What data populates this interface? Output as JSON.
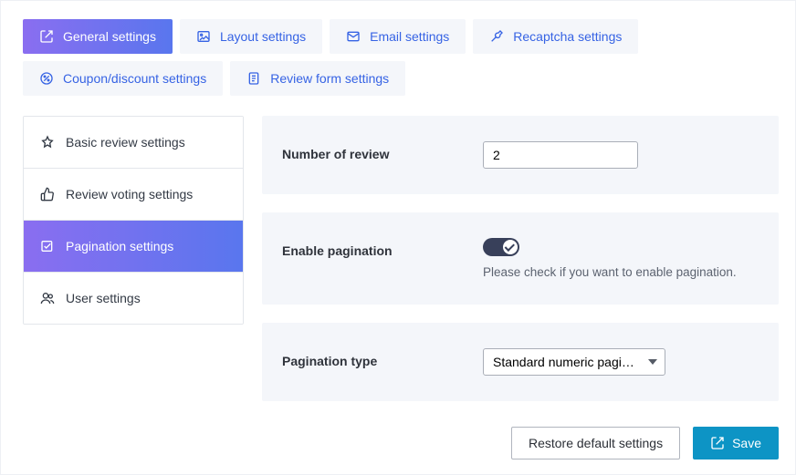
{
  "tabs": {
    "general": {
      "label": "General settings"
    },
    "layout": {
      "label": "Layout settings"
    },
    "email": {
      "label": "Email settings"
    },
    "recaptcha": {
      "label": "Recaptcha settings"
    },
    "coupon": {
      "label": "Coupon/discount settings"
    },
    "reviewform": {
      "label": "Review form settings"
    }
  },
  "sidebar": {
    "basic": {
      "label": "Basic review settings"
    },
    "voting": {
      "label": "Review voting settings"
    },
    "pagination": {
      "label": "Pagination settings"
    },
    "user": {
      "label": "User settings"
    }
  },
  "fields": {
    "numberOfReview": {
      "label": "Number of review",
      "value": "2"
    },
    "enablePagination": {
      "label": "Enable pagination",
      "checked": true,
      "help": "Please check if you want to enable pagination."
    },
    "paginationType": {
      "label": "Pagination type",
      "value": "Standard numeric pagination"
    }
  },
  "footer": {
    "restore": {
      "label": "Restore default settings"
    },
    "save": {
      "label": "Save"
    }
  },
  "colors": {
    "accent": "#5976ee",
    "teal": "#0d94c5"
  }
}
